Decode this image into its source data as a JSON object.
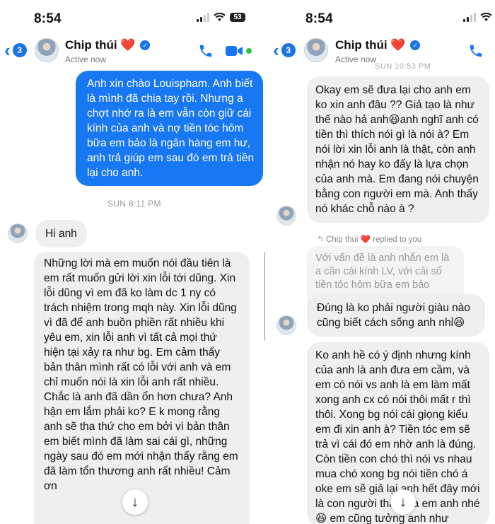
{
  "left": {
    "status": {
      "time": "8:54",
      "battery": "53"
    },
    "header": {
      "back_count": "3",
      "contact_name": "Chip thúi",
      "heart": "❤️",
      "active": "Active now"
    },
    "messages": {
      "sent_1": "Anh xin chào Louispham. Anh biết là mình đã chia tay rồi. Nhưng a chợt nhớ ra là em vẫn còn giữ cái kính của anh và nợ tiền tóc hôm bữa em bảo là ngân hàng em hư, anh trả giúp em sau đó em trả tiền lại cho anh.",
      "timestamp": "SUN 8:11 PM",
      "recv_1": "Hi anh",
      "recv_2": "Những lời mà em muốn nói đầu tiên là em rất muốn gửi lời xin lỗi tới dũng. Xin lỗi dũng vì em đã ko làm dc 1 ny có trách nhiệm trong mqh này. Xin lỗi dũng vì đã để anh buồn phiền rất nhiều khi yêu em, xin lỗi anh vì tất cả mọi thứ hiện tại xảy ra như bg. Em cảm thấy bản thân mình rất có lỗi với anh và em chỉ muốn nói là xin lỗi anh rất nhiều. Chắc là anh đã dần ổn hơn chưa? Anh hận em lắm phải ko? E k mong rằng anh sẽ tha thứ cho em bởi vì bản thân em biết mình đã làm sai cái gì, những ngày sau đó em mới nhận thấy rằng em đã làm tổn thương anh rất nhiều! Cảm ơn"
    }
  },
  "right": {
    "status": {
      "time": "8:54"
    },
    "header": {
      "back_count": "3",
      "contact_name": "Chip thúi",
      "heart": "❤️",
      "active": "Active now",
      "cut_timestamp": "SUN 10:53 PM"
    },
    "messages": {
      "recv_1": "Okay em sẽ đưa lại cho anh em ko xin anh đâu ?? Giả tạo là như thế nào hả anh😆anh nghĩ anh có tiền thì thích nói gì là nói à? Em nói lời xin lỗi anh là thật, còn anh nhận nó hay ko đấy là lựa chọn của anh mà. Em đang nói chuyện bằng con người em mà. Anh thấy nó khác chỗ nào à ?",
      "reply_meta": "Chip thúi ❤️ replied to you",
      "quoted": "Với vấn đề là anh nhắn em là a cần cái kính LV, với cái sổ tiền tóc hôm bữa em bảo mượn...",
      "recv_2": "Đúng là ko phải người giàu nào cũng biết cách sống anh nhỉ😆",
      "sent_1": "Ko anh hề có ý định nhưng kính của anh là anh đưa em cầm, và em có nói vs anh là em làm mất xong anh cx có nói thôi mất r thì thôi. Xong bg nói cái giọng kiểu em đi xin anh à? Tiền tóc em sẽ trả vì cái đó em nhờ anh là đúng. Còn tiền con chó thì nói vs nhau mua chó xong bg nói tiền chó á oke em sẽ giả lại anh hết đây mới là con người thật của em anh nhé😆 em cũng tưởng anh như"
    }
  },
  "colors": {
    "accent": "#1877f2",
    "bubble_grey": "#efefef"
  }
}
